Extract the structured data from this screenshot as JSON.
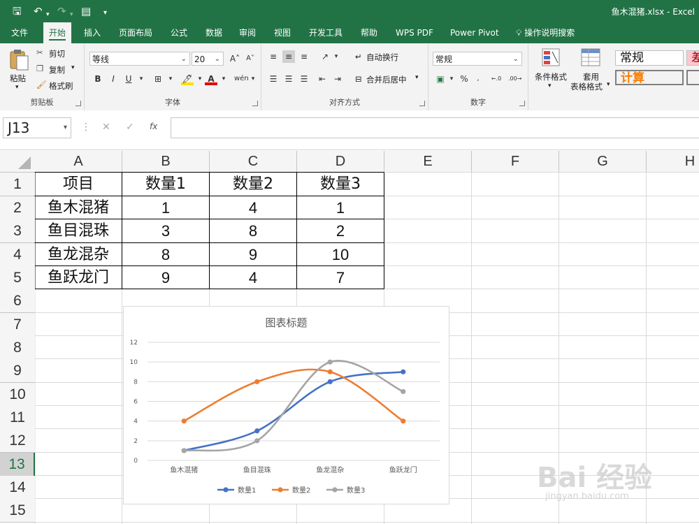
{
  "titlebar": {
    "filename": "鱼木混猪.xlsx",
    "app": "Excel"
  },
  "tabs": [
    "文件",
    "开始",
    "插入",
    "页面布局",
    "公式",
    "数据",
    "审阅",
    "视图",
    "开发工具",
    "帮助",
    "WPS PDF",
    "Power Pivot",
    "操作说明搜索"
  ],
  "ribbon": {
    "clipboard": {
      "paste": "粘贴",
      "cut": "剪切",
      "copy": "复制",
      "format_painter": "格式刷",
      "label": "剪贴板"
    },
    "font": {
      "name": "等线",
      "size": "20",
      "bold": "B",
      "italic": "I",
      "underline": "U",
      "label": "字体"
    },
    "alignment": {
      "wrap": "自动换行",
      "merge": "合并后居中",
      "label": "对齐方式"
    },
    "number": {
      "format": "常规",
      "percent": "%",
      "label": "数字"
    },
    "styles": {
      "conditional": "条件格式",
      "table1": "套用",
      "table2": "表格格式",
      "normal": "常规",
      "calc": "计算",
      "partial": "差"
    }
  },
  "formula_bar": {
    "name_box": "J13",
    "fx": "fx",
    "value": ""
  },
  "grid": {
    "columns": [
      "A",
      "B",
      "C",
      "D",
      "E",
      "F",
      "G",
      "H"
    ],
    "rows": [
      "1",
      "2",
      "3",
      "4",
      "5",
      "6",
      "7",
      "8",
      "9",
      "10",
      "11",
      "12",
      "13",
      "14",
      "15"
    ],
    "selected_row": "13",
    "table": [
      [
        "项目",
        "数量1",
        "数量2",
        "数量3"
      ],
      [
        "鱼木混猪",
        "1",
        "4",
        "1"
      ],
      [
        "鱼目混珠",
        "3",
        "8",
        "2"
      ],
      [
        "鱼龙混杂",
        "8",
        "9",
        "10"
      ],
      [
        "鱼跃龙门",
        "9",
        "4",
        "7"
      ]
    ]
  },
  "chart_data": {
    "type": "line",
    "title": "图表标题",
    "categories": [
      "鱼木混猪",
      "鱼目混珠",
      "鱼龙混杂",
      "鱼跃龙门"
    ],
    "series": [
      {
        "name": "数量1",
        "values": [
          1,
          3,
          8,
          9
        ],
        "color": "#4472c4"
      },
      {
        "name": "数量2",
        "values": [
          4,
          8,
          9,
          4
        ],
        "color": "#ed7d31"
      },
      {
        "name": "数量3",
        "values": [
          1,
          2,
          10,
          7
        ],
        "color": "#a5a5a5"
      }
    ],
    "ylim": [
      0,
      12
    ],
    "yticks": [
      0,
      2,
      4,
      6,
      8,
      10,
      12
    ],
    "smooth": true,
    "grid": true,
    "legend": "bottom"
  },
  "watermark": {
    "brand": "Bai 经验",
    "url": "jingyan.baidu.com"
  }
}
